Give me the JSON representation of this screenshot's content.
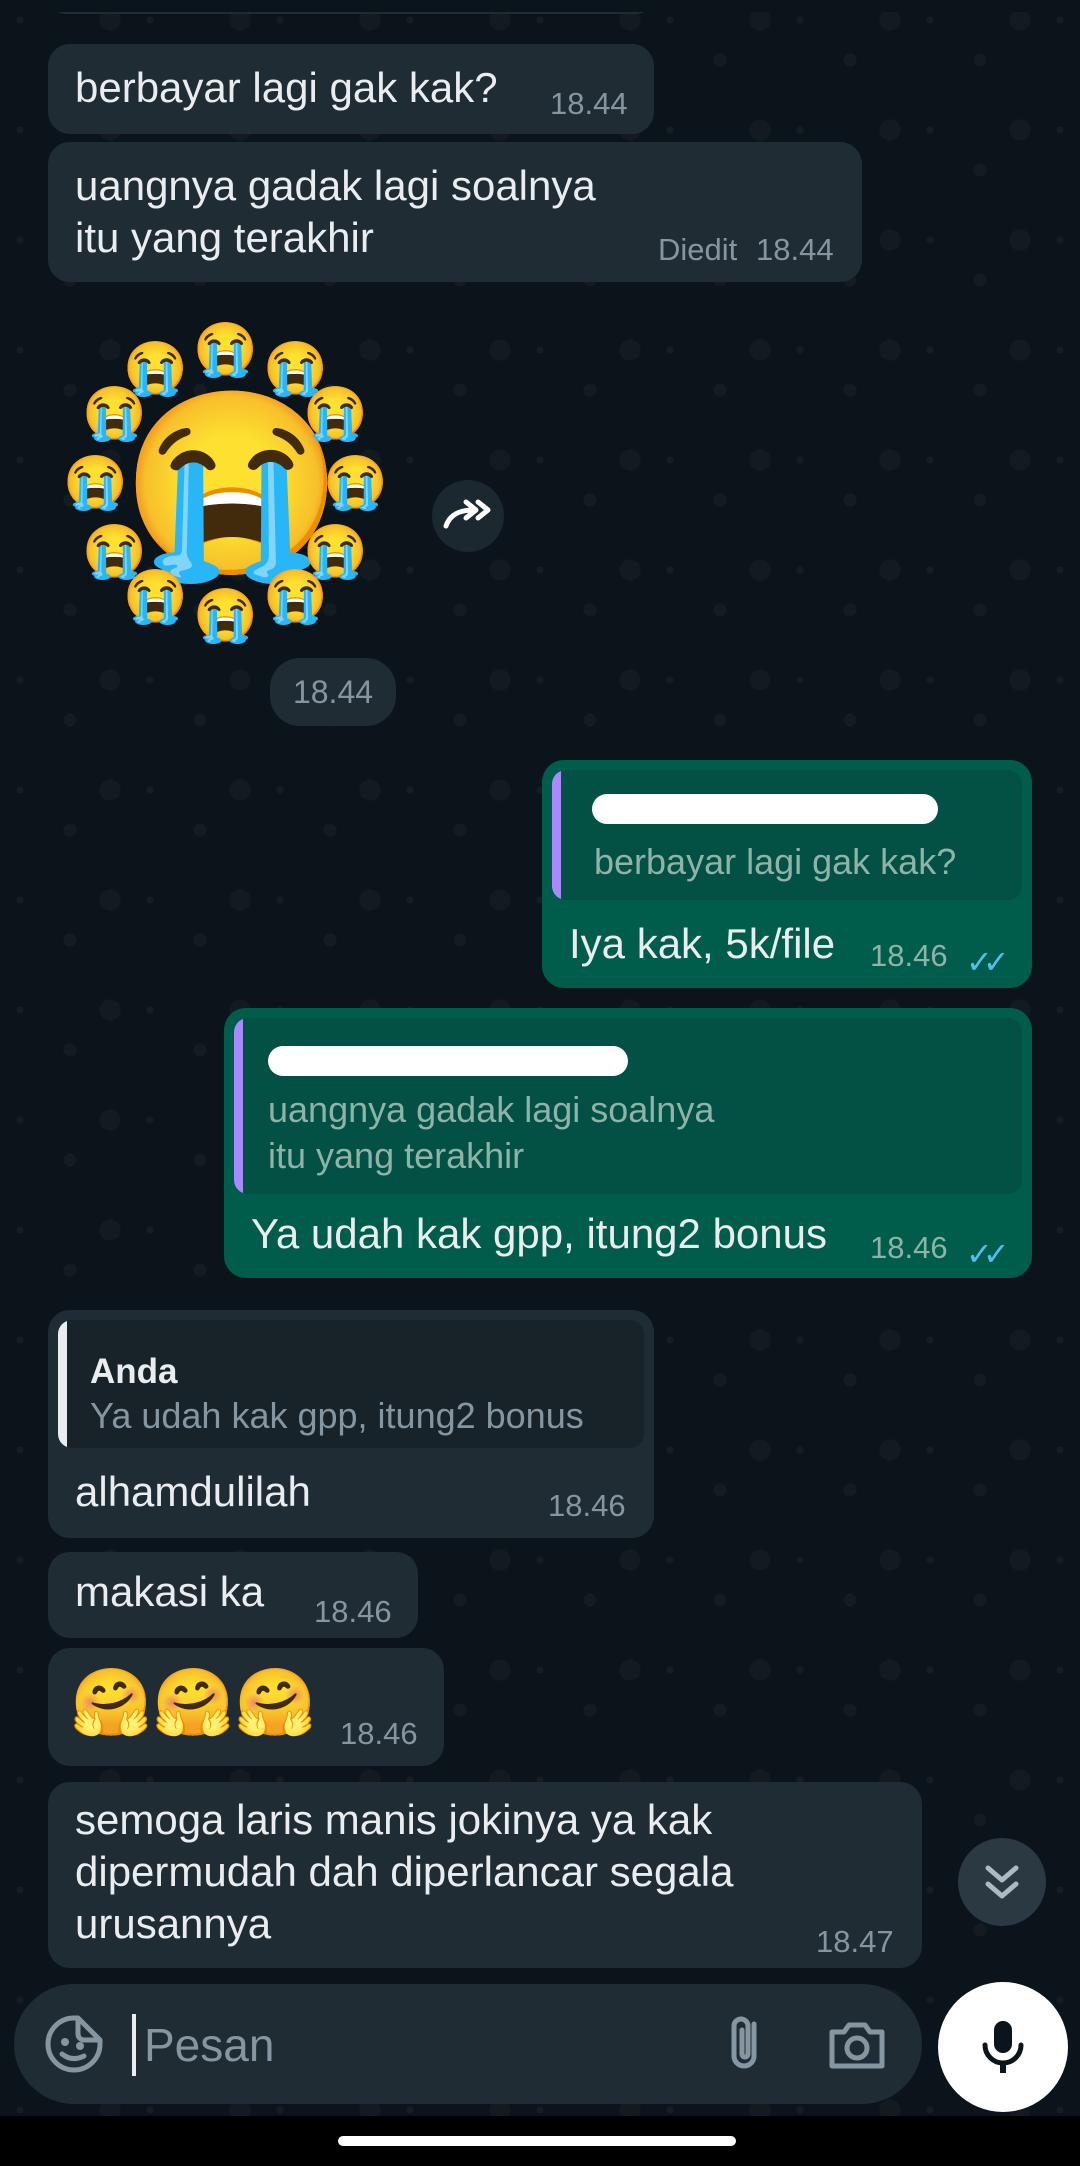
{
  "messages": {
    "m1": {
      "text": "berbayar lagi gak kak?",
      "time": "18.44"
    },
    "m2": {
      "line1": "uangnya gadak lagi soalnya",
      "line2": "itu yang terakhir",
      "edited": "Diedit",
      "time": "18.44"
    },
    "sticker": {
      "big": "😭",
      "small": "😭",
      "time": "18.44"
    },
    "m3": {
      "quote": "berbayar lagi gak kak?",
      "text": "Iya kak, 5k/file",
      "time": "18.46",
      "ticks": "✓✓"
    },
    "m4": {
      "quote_line1": "uangnya gadak lagi soalnya",
      "quote_line2": "itu yang terakhir",
      "text": "Ya udah kak gpp, itung2 bonus",
      "time": "18.46",
      "ticks": "✓✓"
    },
    "m5": {
      "quote_name": "Anda",
      "quote": "Ya udah kak gpp, itung2 bonus",
      "text": "alhamdulilah",
      "time": "18.46"
    },
    "m6": {
      "text": "makasi ka",
      "time": "18.46"
    },
    "m7": {
      "text": "🤗🤗🤗",
      "time": "18.46"
    },
    "m8": {
      "line1": "semoga laris manis jokinya ya kak",
      "line2": "dipermudah dah diperlancar segala",
      "line3": "urusannya",
      "time": "18.47"
    }
  },
  "input": {
    "placeholder": "Pesan"
  },
  "icons": {
    "forward": "forward-icon",
    "scroll_down": "chevrons-down-icon",
    "emoji": "sticker-emoji-icon",
    "attach": "paperclip-icon",
    "camera": "camera-icon",
    "mic": "mic-icon"
  },
  "colors": {
    "background": "#0b141a",
    "incoming_bubble": "#1f2c34",
    "outgoing_bubble": "#005c4b",
    "read_ticks": "#53bdeb",
    "quote_bar_out": "#a78bfa"
  }
}
